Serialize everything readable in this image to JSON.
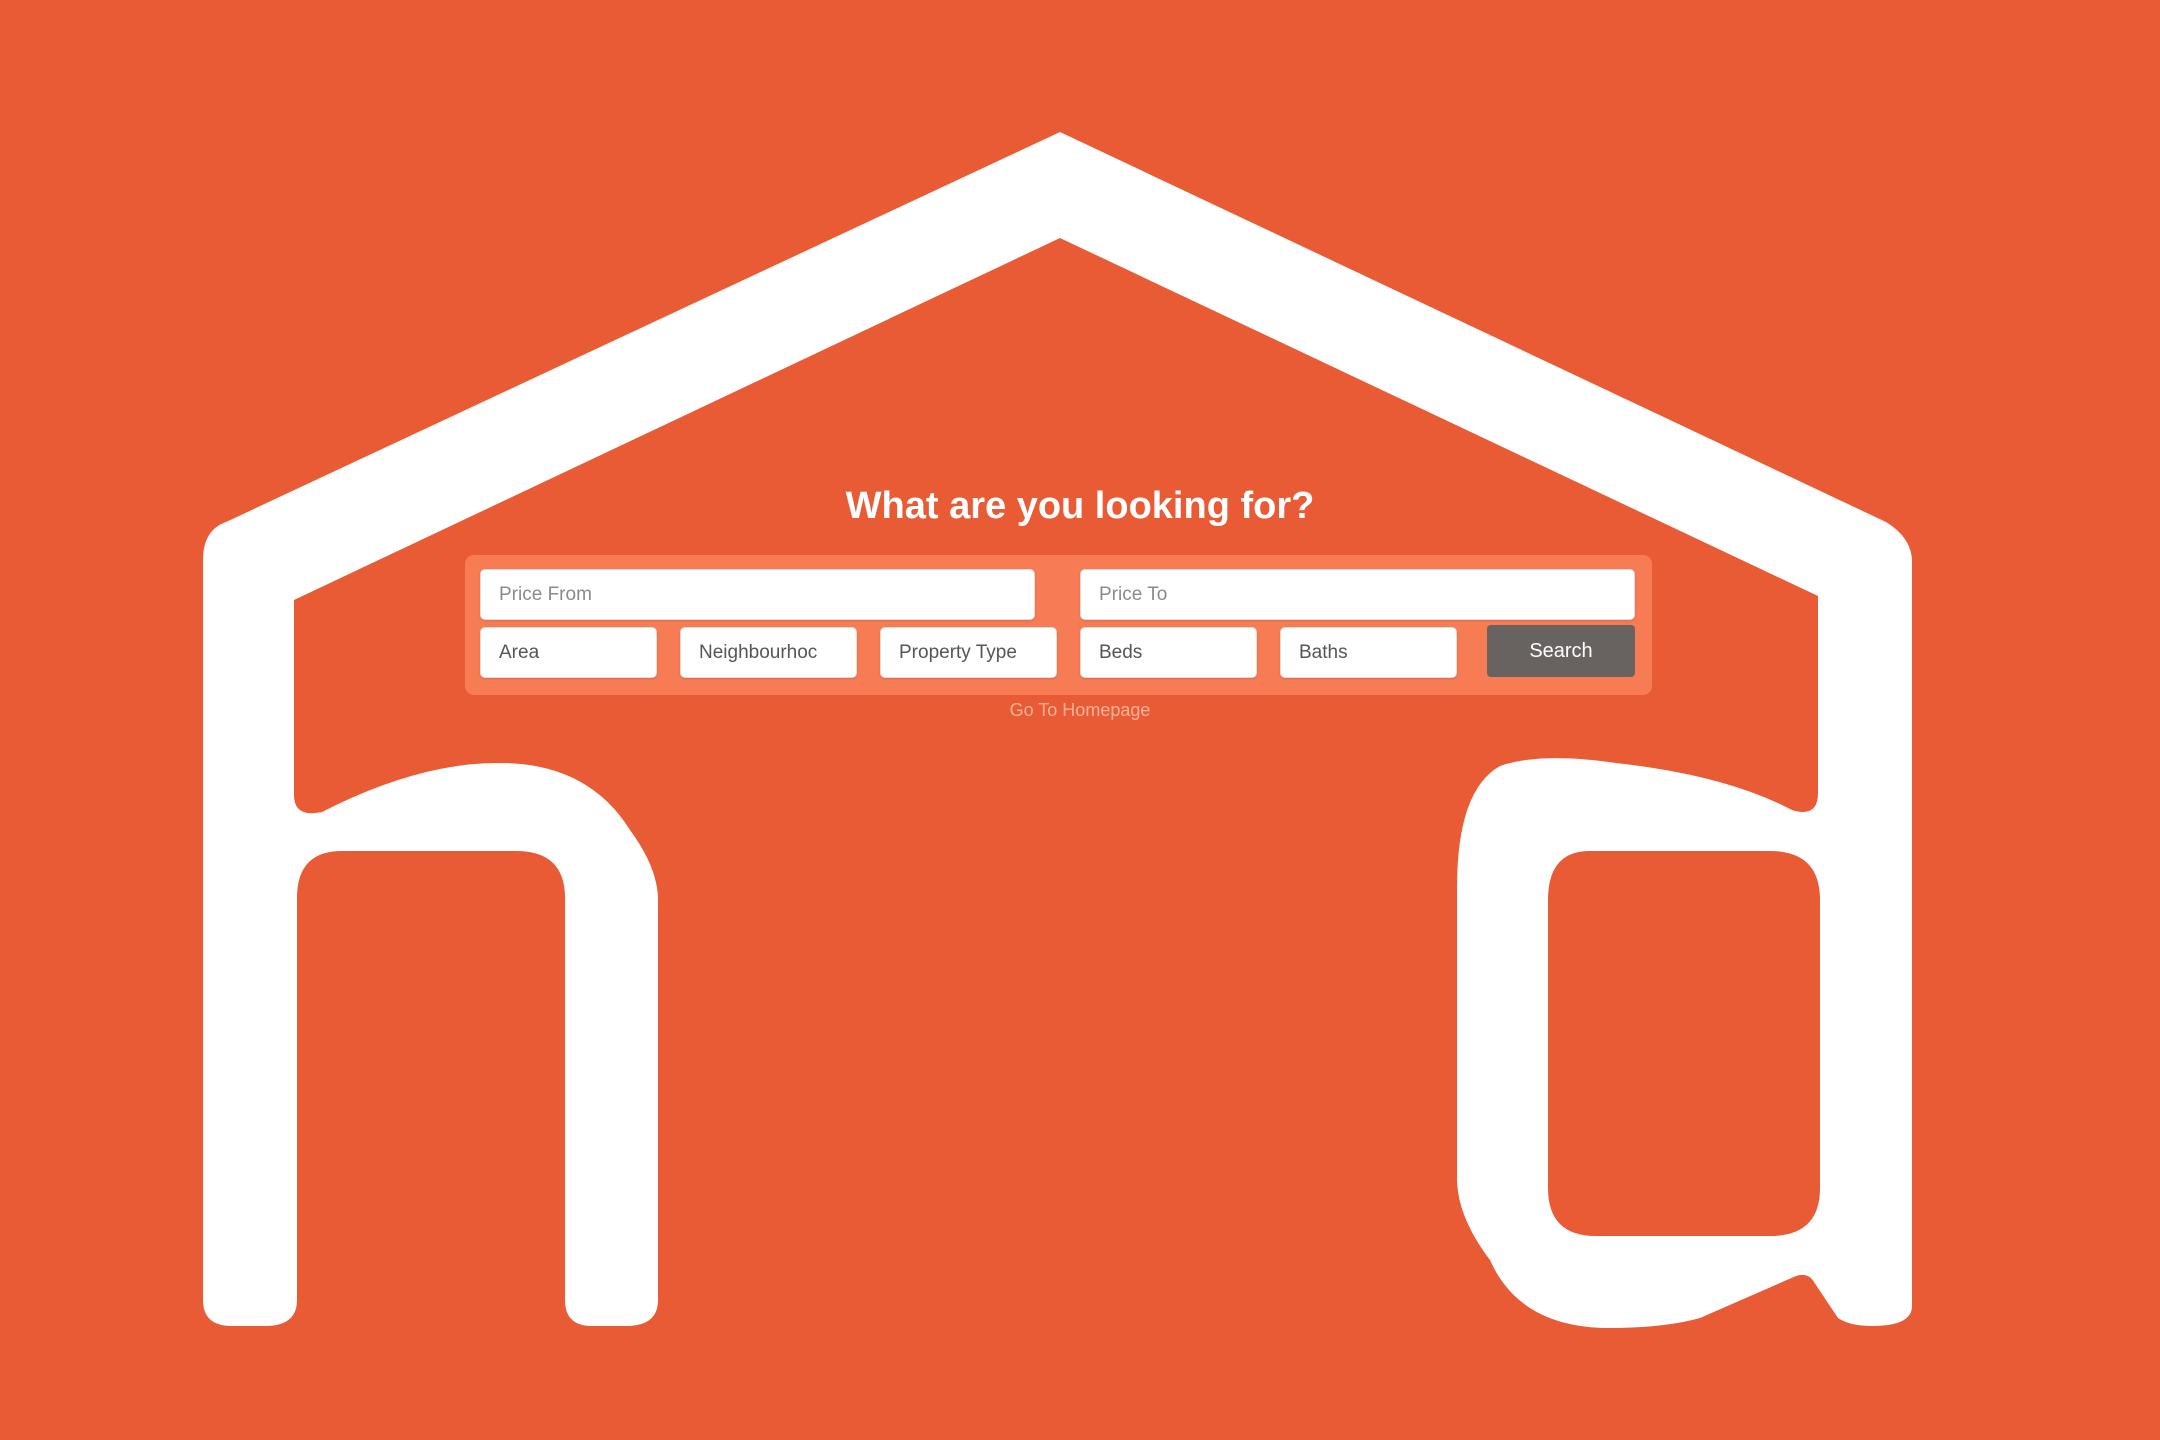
{
  "brand": {
    "background_color": "#e95b34",
    "panel_color": "#f77b53",
    "logo_color": "#ffffff",
    "button_color": "#686361",
    "link_color": "#f6b299"
  },
  "logo": {
    "icon": "house-ha-logo"
  },
  "search": {
    "heading": "What are you looking for?",
    "price_from_placeholder": "Price From",
    "price_to_placeholder": "Price To",
    "area": "Area",
    "neighbourhood": "Neighbourhoc",
    "property_type": "Property Type",
    "beds": "Beds",
    "baths": "Baths",
    "button_label": "Search"
  },
  "footer": {
    "home_link": "Go To Homepage"
  }
}
